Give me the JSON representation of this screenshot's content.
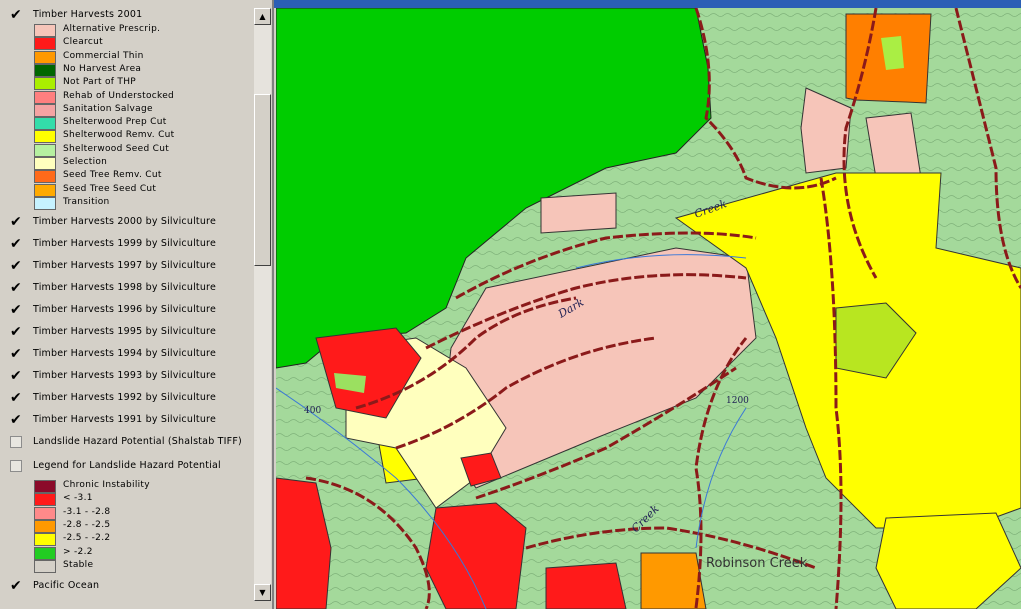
{
  "legend": {
    "layer_2001": {
      "label": "Timber Harvests 2001",
      "classes": [
        {
          "label": "Alternative Prescrip.",
          "color": "#f6c5b9"
        },
        {
          "label": "Clearcut",
          "color": "#ff1a1a"
        },
        {
          "label": "Commercial Thin",
          "color": "#ff9900"
        },
        {
          "label": "No Harvest Area",
          "color": "#006600"
        },
        {
          "label": "Not Part of THP",
          "color": "#aaee00"
        },
        {
          "label": "Rehab of Understocked",
          "color": "#ff7f7f"
        },
        {
          "label": "Sanitation Salvage",
          "color": "#f5a3a3"
        },
        {
          "label": "Shelterwood Prep Cut",
          "color": "#33ddaa"
        },
        {
          "label": "Shelterwood Remv. Cut",
          "color": "#ffff00"
        },
        {
          "label": "Shelterwood Seed Cut",
          "color": "#b6f0a0"
        },
        {
          "label": "Selection",
          "color": "#ffffbe"
        },
        {
          "label": "Seed Tree Remv. Cut",
          "color": "#ff6a1a"
        },
        {
          "label": "Seed Tree Seed Cut",
          "color": "#ffaa00"
        },
        {
          "label": "Transition",
          "color": "#c6f2ff"
        }
      ]
    },
    "layers": [
      {
        "label": "Timber Harvests 2000 by Silviculture",
        "checked": true
      },
      {
        "label": "Timber Harvests 1999 by Silviculture",
        "checked": true
      },
      {
        "label": "Timber Harvests 1997 by Silviculture",
        "checked": true
      },
      {
        "label": "Timber Harvests 1998 by Silviculture",
        "checked": true
      },
      {
        "label": "Timber Harvests 1996 by Silviculture",
        "checked": true
      },
      {
        "label": "Timber Harvests 1995 by Silviculture",
        "checked": true
      },
      {
        "label": "Timber Harvests 1994 by Silviculture",
        "checked": true
      },
      {
        "label": "Timber Harvests 1993 by Silviculture",
        "checked": true
      },
      {
        "label": "Timber Harvests 1992 by Silviculture",
        "checked": true
      },
      {
        "label": "Timber Harvests 1991 by Silviculture",
        "checked": true
      },
      {
        "label": "Landslide Hazard Potential (Shalstab TIFF)",
        "checked": false
      },
      {
        "label": "Legend for Landslide Hazard Potential",
        "checked": false
      }
    ],
    "landslide_classes": [
      {
        "label": "Chronic Instability",
        "color": "#8b0a2a"
      },
      {
        "label": "<  -3.1",
        "color": "#ff1a1a"
      },
      {
        "label": "-3.1 - -2.8",
        "color": "#ff8a8a"
      },
      {
        "label": "-2.8 - -2.5",
        "color": "#ff9900"
      },
      {
        "label": "-2.5 - -2.2",
        "color": "#ffff00"
      },
      {
        "label": "> -2.2",
        "color": "#22cc22"
      },
      {
        "label": "Stable",
        "color": "#d4d0c8"
      }
    ],
    "pacific_ocean": {
      "label": "Pacific Ocean",
      "checked": true
    }
  },
  "map": {
    "place_label": "Robinson Creek"
  }
}
